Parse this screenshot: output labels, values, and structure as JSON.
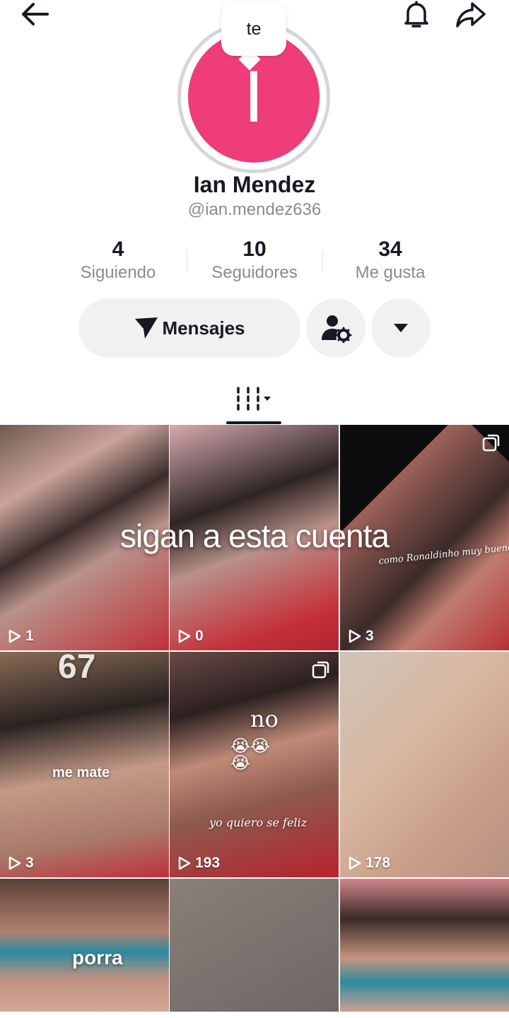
{
  "profile": {
    "avatar_letter": "I",
    "avatar_color": "#ee3d78",
    "note": "te",
    "name": "Ian Mendez",
    "handle": "@ian.mendez636"
  },
  "stats": [
    {
      "value": "4",
      "label": "Siguiendo"
    },
    {
      "value": "10",
      "label": "Seguidores"
    },
    {
      "value": "34",
      "label": "Me gusta"
    }
  ],
  "actions": {
    "message_label": "Mensajes"
  },
  "banner_text": "sigan a esta cuenta",
  "videos": [
    {
      "views": "1",
      "caption": ""
    },
    {
      "views": "0",
      "caption": ""
    },
    {
      "views": "3",
      "caption": "como Ronaldinho muy bueno e nel fuchibol"
    },
    {
      "views": "3",
      "caption": "me mate",
      "top_text": "67"
    },
    {
      "views": "193",
      "caption": "yo quiero se feliz",
      "top_text": "no",
      "emoji": "😭😭😭"
    },
    {
      "views": "178",
      "caption": ""
    },
    {
      "views": "",
      "caption": "porra"
    },
    {
      "views": "",
      "caption": ""
    },
    {
      "views": "",
      "caption": ""
    }
  ],
  "icons": [
    "back-arrow-icon",
    "bell-icon",
    "share-icon",
    "send-icon",
    "person-gear-icon",
    "caret-down-icon",
    "grid-icon",
    "play-icon",
    "multi-photo-icon"
  ]
}
